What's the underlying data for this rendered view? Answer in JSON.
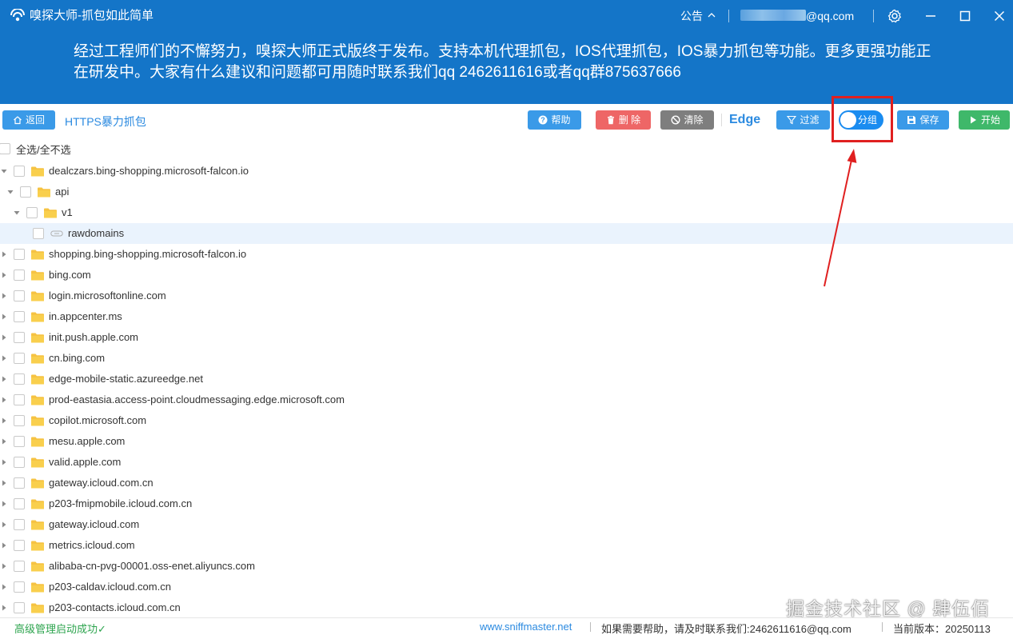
{
  "window": {
    "title": "嗅探大师-抓包如此简单",
    "notice_label": "公告",
    "notice_caret": "^",
    "email_visible": "@qq.com"
  },
  "banner": {
    "text": "经过工程师们的不懈努力，嗅探大师正式版终于发布。支持本机代理抓包，IOS代理抓包，IOS暴力抓包等功能。更多更强功能正在研发中。大家有什么建议和问题都可用随时联系我们qq 2462611616或者qq群875637666"
  },
  "toolbar": {
    "back_label": "返回",
    "page_title": "HTTPS暴力抓包",
    "help_label": "帮助",
    "delete_label": "删 除",
    "clear_label": "清除",
    "browser_label": "Edge",
    "filter_label": "过滤",
    "group_label": "分组",
    "save_label": "保存",
    "start_label": "开始",
    "colors": {
      "help": "#3a9ae8",
      "delete": "#ee6666",
      "clear": "#7e7e7e",
      "filter": "#3a9ae8",
      "toggle": "#1a8cf0",
      "save": "#3a9ae8",
      "start": "#3fb86a"
    }
  },
  "tree": {
    "select_all_label": "全选/全不选",
    "rows": [
      {
        "label": "dealczars.bing-shopping.microsoft-falcon.io",
        "level": 0,
        "expanded": true,
        "type": "folder"
      },
      {
        "label": "api",
        "level": 1,
        "expanded": true,
        "type": "folder"
      },
      {
        "label": "v1",
        "level": 2,
        "expanded": true,
        "type": "folder"
      },
      {
        "label": "rawdomains",
        "level": 3,
        "expanded": false,
        "type": "link",
        "selected": true
      },
      {
        "label": "shopping.bing-shopping.microsoft-falcon.io",
        "level": 0,
        "expanded": false,
        "type": "folder"
      },
      {
        "label": "bing.com",
        "level": 0,
        "expanded": false,
        "type": "folder"
      },
      {
        "label": "login.microsoftonline.com",
        "level": 0,
        "expanded": false,
        "type": "folder"
      },
      {
        "label": "in.appcenter.ms",
        "level": 0,
        "expanded": false,
        "type": "folder"
      },
      {
        "label": "init.push.apple.com",
        "level": 0,
        "expanded": false,
        "type": "folder"
      },
      {
        "label": "cn.bing.com",
        "level": 0,
        "expanded": false,
        "type": "folder"
      },
      {
        "label": "edge-mobile-static.azureedge.net",
        "level": 0,
        "expanded": false,
        "type": "folder"
      },
      {
        "label": "prod-eastasia.access-point.cloudmessaging.edge.microsoft.com",
        "level": 0,
        "expanded": false,
        "type": "folder"
      },
      {
        "label": "copilot.microsoft.com",
        "level": 0,
        "expanded": false,
        "type": "folder"
      },
      {
        "label": "mesu.apple.com",
        "level": 0,
        "expanded": false,
        "type": "folder"
      },
      {
        "label": "valid.apple.com",
        "level": 0,
        "expanded": false,
        "type": "folder"
      },
      {
        "label": "gateway.icloud.com.cn",
        "level": 0,
        "expanded": false,
        "type": "folder"
      },
      {
        "label": "p203-fmipmobile.icloud.com.cn",
        "level": 0,
        "expanded": false,
        "type": "folder"
      },
      {
        "label": "gateway.icloud.com",
        "level": 0,
        "expanded": false,
        "type": "folder"
      },
      {
        "label": "metrics.icloud.com",
        "level": 0,
        "expanded": false,
        "type": "folder"
      },
      {
        "label": "alibaba-cn-pvg-00001.oss-enet.aliyuncs.com",
        "level": 0,
        "expanded": false,
        "type": "folder"
      },
      {
        "label": "p203-caldav.icloud.com.cn",
        "level": 0,
        "expanded": false,
        "type": "folder"
      },
      {
        "label": "p203-contacts.icloud.com.cn",
        "level": 0,
        "expanded": false,
        "type": "folder"
      }
    ]
  },
  "statusbar": {
    "status_text": "高级管理启动成功✓",
    "website": "www.sniffmaster.net",
    "help_text": "如果需要帮助，请及时联系我们:2462611616@qq.com",
    "version_text": "当前版本：20250113"
  },
  "watermark": "掘金技术社区 @ 肆伍佰"
}
